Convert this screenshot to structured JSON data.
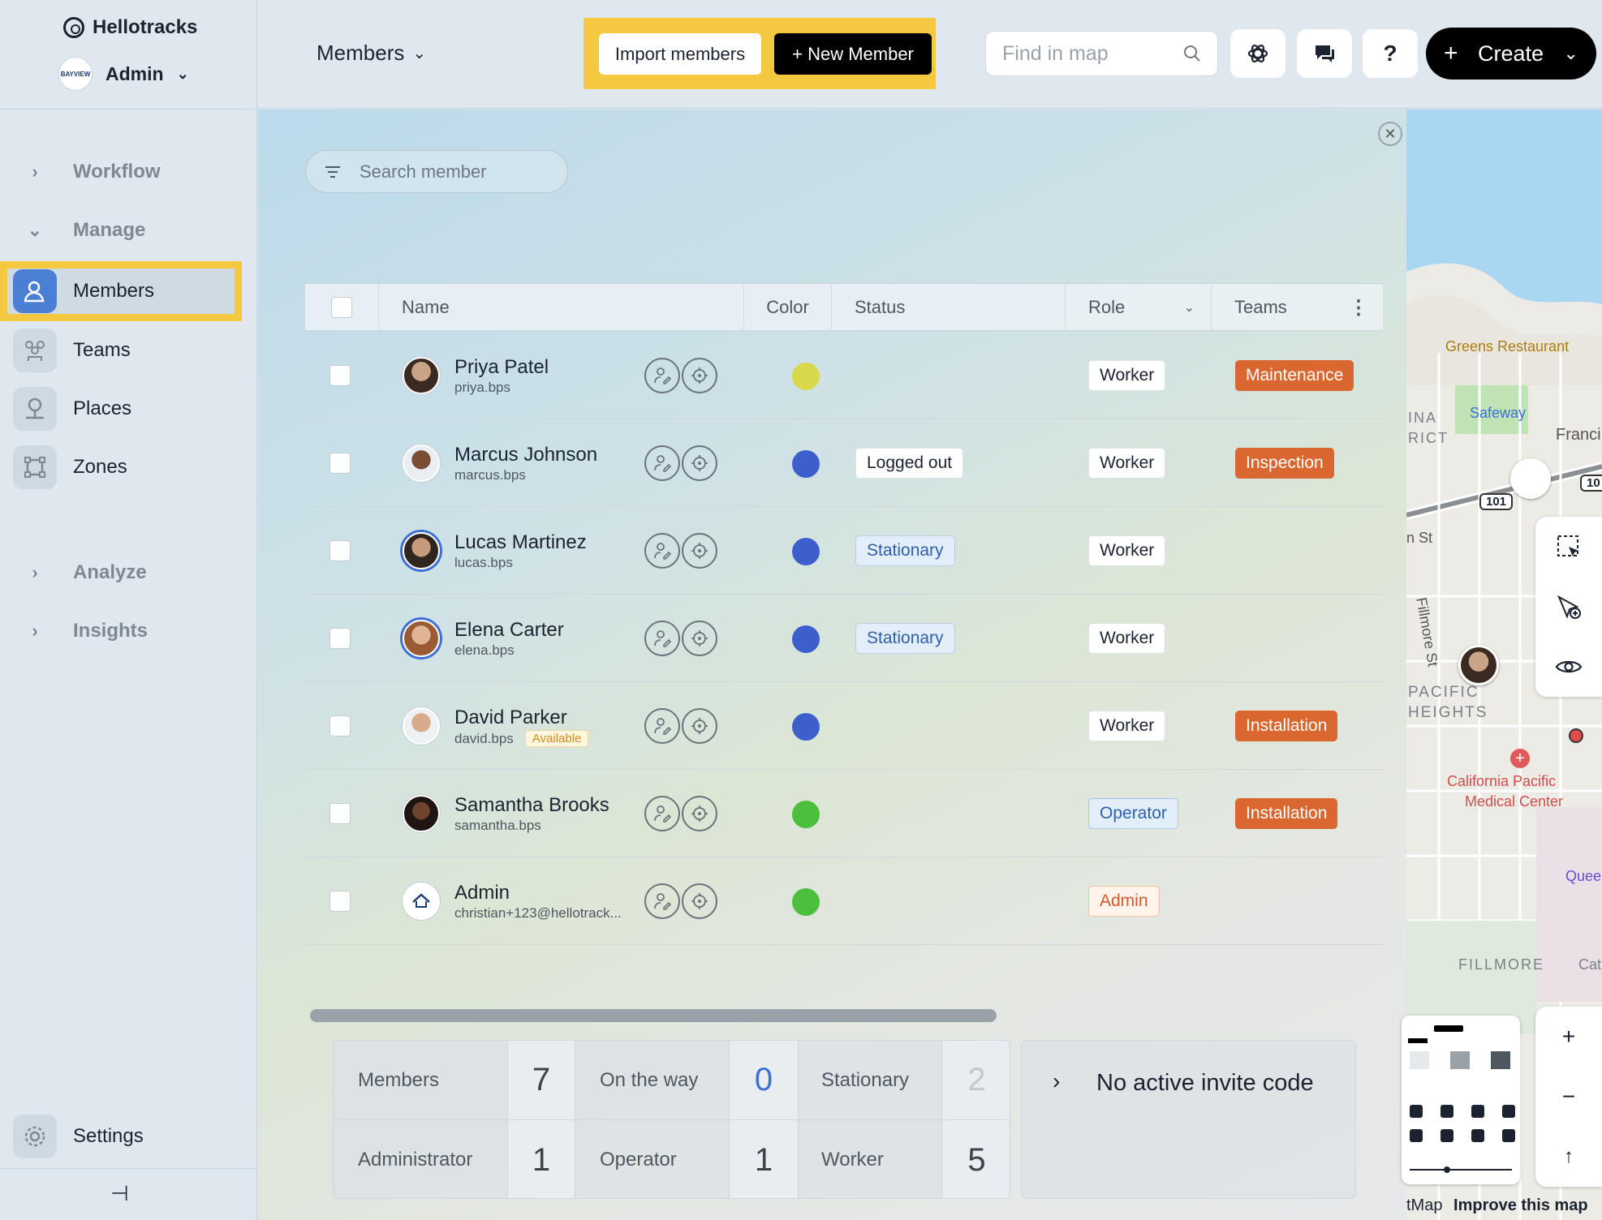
{
  "app": {
    "name": "Hellotracks",
    "account": "Admin",
    "account_logo_text": "BAYVIEW"
  },
  "sidebar": {
    "sections": [
      {
        "label": "Workflow",
        "expanded": false
      },
      {
        "label": "Manage",
        "expanded": true
      },
      {
        "label": "Analyze",
        "expanded": false
      },
      {
        "label": "Insights",
        "expanded": false
      }
    ],
    "items": [
      {
        "label": "Members",
        "icon": "members-icon",
        "active": true
      },
      {
        "label": "Teams",
        "icon": "teams-icon"
      },
      {
        "label": "Places",
        "icon": "places-icon"
      },
      {
        "label": "Zones",
        "icon": "zones-icon"
      }
    ],
    "settings_label": "Settings",
    "pin_icon": "⊣"
  },
  "topbar": {
    "page_dropdown": "Members",
    "import_label": "Import members",
    "new_member_label": "+ New Member",
    "find_placeholder": "Find in map",
    "help_label": "?",
    "create_label": "Create"
  },
  "members_panel": {
    "search_placeholder": "Search member",
    "columns": [
      "Name",
      "Color",
      "Status",
      "Role",
      "Teams"
    ],
    "rows": [
      {
        "name": "Priya Patel",
        "user": "priya.bps",
        "color": "#d9d84a",
        "status": "",
        "role": "Worker",
        "team": "Maintenance"
      },
      {
        "name": "Marcus Johnson",
        "user": "marcus.bps",
        "color": "#3d5fcc",
        "status": "Logged out",
        "role": "Worker",
        "team": "Inspection"
      },
      {
        "name": "Lucas Martinez",
        "user": "lucas.bps",
        "color": "#3d5fcc",
        "status": "Stationary",
        "role": "Worker",
        "team": ""
      },
      {
        "name": "Elena Carter",
        "user": "elena.bps",
        "color": "#3d5fcc",
        "status": "Stationary",
        "role": "Worker",
        "team": ""
      },
      {
        "name": "David Parker",
        "user": "david.bps",
        "badge": "Available",
        "color": "#3d5fcc",
        "status": "",
        "role": "Worker",
        "team": "Installation"
      },
      {
        "name": "Samantha Brooks",
        "user": "samantha.bps",
        "color": "#4cbf3e",
        "status": "",
        "role": "Operator",
        "team": "Installation"
      },
      {
        "name": "Admin",
        "user": "christian+123@hellotrack...",
        "color": "#4cbf3e",
        "status": "",
        "role": "Admin",
        "team": ""
      }
    ]
  },
  "stats": {
    "members_label": "Members",
    "members": "7",
    "on_the_way_label": "On the way",
    "on_the_way": "0",
    "stationary_label": "Stationary",
    "stationary": "2",
    "administrator_label": "Administrator",
    "administrator": "1",
    "operator_label": "Operator",
    "operator": "1",
    "worker_label": "Worker",
    "worker": "5"
  },
  "invite": {
    "label": "No active invite code"
  },
  "map": {
    "labels": [
      "Greens Restaurant",
      "Safeway",
      "INA",
      "RICT",
      "Franci",
      "101",
      "10",
      "n St",
      "Fillmore St",
      "PACIFIC",
      "HEIGHTS",
      "California Pacific",
      "Medical Center",
      "Quee",
      "FILLMORE",
      "Cath"
    ],
    "attribution": "tMap",
    "improve": "Improve this map"
  }
}
